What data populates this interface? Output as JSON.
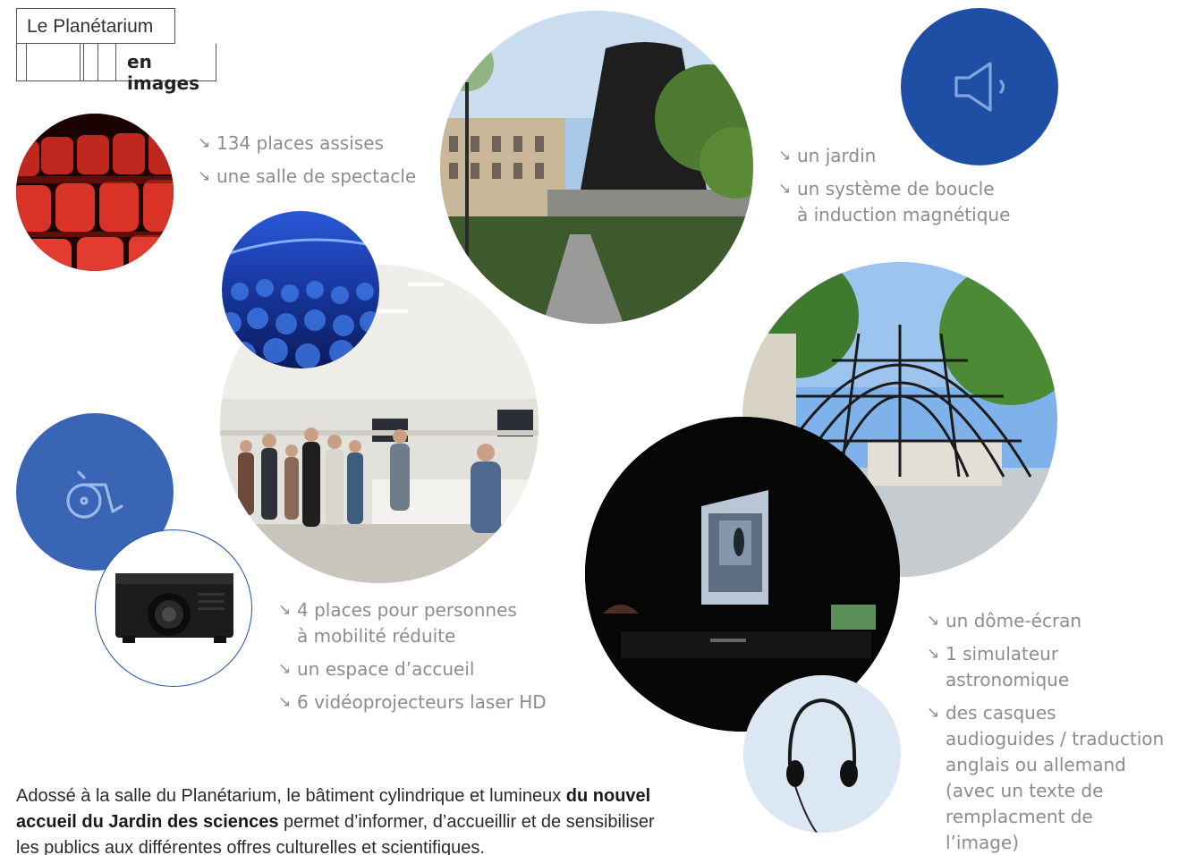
{
  "header": {
    "title": "Le Planétarium",
    "subtitle": "en images"
  },
  "list_theatre": [
    {
      "arrow": "↘",
      "text": "134 places assises"
    },
    {
      "arrow": "↘",
      "text": "une salle de spectacle"
    }
  ],
  "list_garden": [
    {
      "arrow": "↘",
      "text": "un jardin"
    },
    {
      "arrow": "↘",
      "text": "un système de boucle\nà induction magnétique"
    }
  ],
  "list_accueil": [
    {
      "arrow": "↘",
      "text": "4 places pour personnes\nà mobilité réduite"
    },
    {
      "arrow": "↘",
      "text": "un espace d’accueil"
    },
    {
      "arrow": "↘",
      "text": "6 vidéoprojecteurs laser HD"
    }
  ],
  "list_dome": [
    {
      "arrow": "↘",
      "text": "un dôme-écran"
    },
    {
      "arrow": "↘",
      "text": "1 simulateur\nastronomique"
    },
    {
      "arrow": "↘",
      "text": "des casques\naudioguides / traduction\nanglais ou allemand\n(avec un texte de\nremplacment de\nl’image)"
    }
  ],
  "paragraph": {
    "part1": "Adossé à la salle du Planétarium, le bâtiment cylindrique et lumineux ",
    "bold": "du nouvel accueil du Jardin des sciences",
    "part2": " permet d’informer, d’accueillir et de sensibiliser les publics aux différentes offres culturelles et scientifiques."
  },
  "icons": {
    "speaker": "speaker-icon",
    "wheelchair": "wheelchair-icon"
  },
  "colors": {
    "icon_circle_dark": "#1f4fa5",
    "icon_circle_mid": "#3a64b4",
    "outline_circle": "#1f4fa5",
    "headphones_bg": "#dce7f4"
  }
}
